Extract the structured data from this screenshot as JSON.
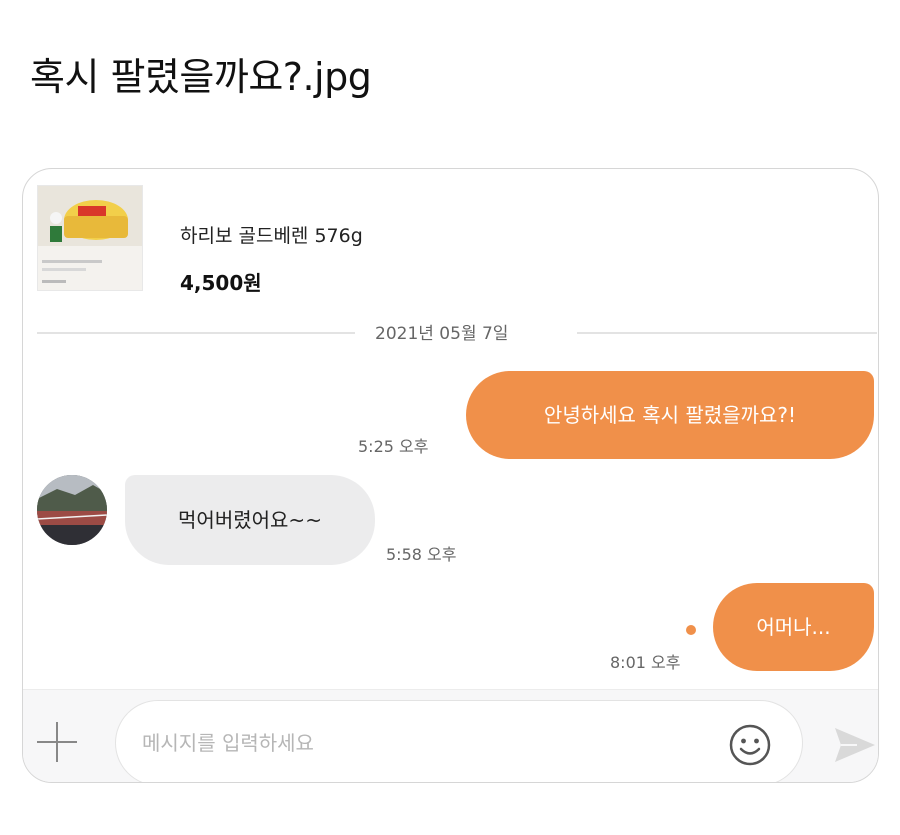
{
  "post": {
    "title": "혹시 팔렸을까요?.jpg"
  },
  "product": {
    "name": "하리보 골드베렌 576g",
    "price": "4,500원"
  },
  "chat": {
    "date": "2021년 05월 7일",
    "messages": [
      {
        "direction": "outgoing",
        "text": "안녕하세요 혹시 팔렸을까요?!",
        "time": "5:25 오후"
      },
      {
        "direction": "incoming",
        "text": "먹어버렸어요~~",
        "time": "5:58 오후"
      },
      {
        "direction": "outgoing",
        "text": "어머나...",
        "time": "8:01 오후",
        "unread": true
      }
    ]
  },
  "input": {
    "placeholder": "메시지를 입력하세요"
  },
  "icons": {
    "add": "plus-icon",
    "emoji": "smile-icon",
    "send": "send-icon"
  },
  "colors": {
    "accent": "#f0904a",
    "incoming_bubble": "#ececed",
    "input_bar": "#f7f7f8"
  }
}
